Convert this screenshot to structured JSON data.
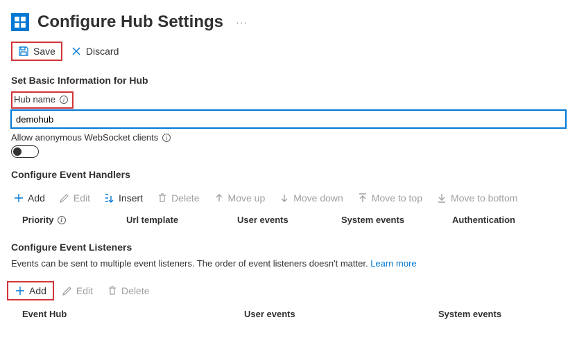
{
  "page": {
    "title": "Configure Hub Settings",
    "ellipsis": "···"
  },
  "commands": {
    "save": "Save",
    "discard": "Discard"
  },
  "basic": {
    "section_title": "Set Basic Information for Hub",
    "hub_name_label": "Hub name",
    "hub_name_value": "demohub",
    "allow_anon_label": "Allow anonymous WebSocket clients"
  },
  "handlers": {
    "section_title": "Configure Event Handlers",
    "toolbar": {
      "add": "Add",
      "edit": "Edit",
      "insert": "Insert",
      "delete": "Delete",
      "move_up": "Move up",
      "move_down": "Move down",
      "move_top": "Move to top",
      "move_bottom": "Move to bottom"
    },
    "columns": {
      "priority": "Priority",
      "url_template": "Url template",
      "user_events": "User events",
      "system_events": "System events",
      "authentication": "Authentication"
    }
  },
  "listeners": {
    "section_title": "Configure Event Listeners",
    "note": "Events can be sent to multiple event listeners. The order of event listeners doesn't matter. ",
    "learn_more": "Learn more",
    "toolbar": {
      "add": "Add",
      "edit": "Edit",
      "delete": "Delete"
    },
    "columns": {
      "event_hub": "Event Hub",
      "user_events": "User events",
      "system_events": "System events"
    }
  }
}
